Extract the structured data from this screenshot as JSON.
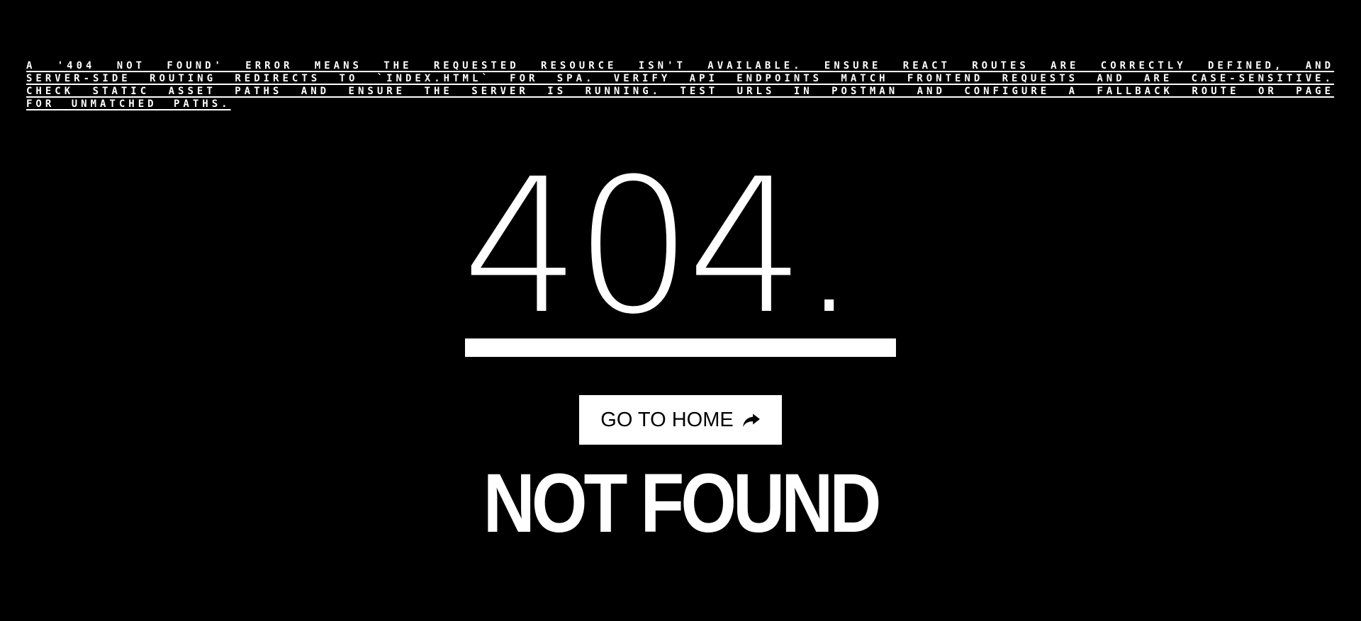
{
  "info": {
    "message": "A '404 Not Found' error means the requested resource isn't available. Ensure React routes are correctly defined, and server-side routing redirects to `index.html` for SPA. Verify API endpoints match frontend requests and are case-sensitive. Check static asset paths and ensure the server is running. Test URLs in Postman and configure a fallback route or page for unmatched paths."
  },
  "error": {
    "code": "404."
  },
  "home_button": {
    "label": "GO TO HOME",
    "icon": "share-arrow-icon"
  },
  "status": {
    "title": "NOT FOUND"
  },
  "colors": {
    "background": "#000000",
    "foreground": "#ffffff",
    "button_text": "#000000"
  }
}
